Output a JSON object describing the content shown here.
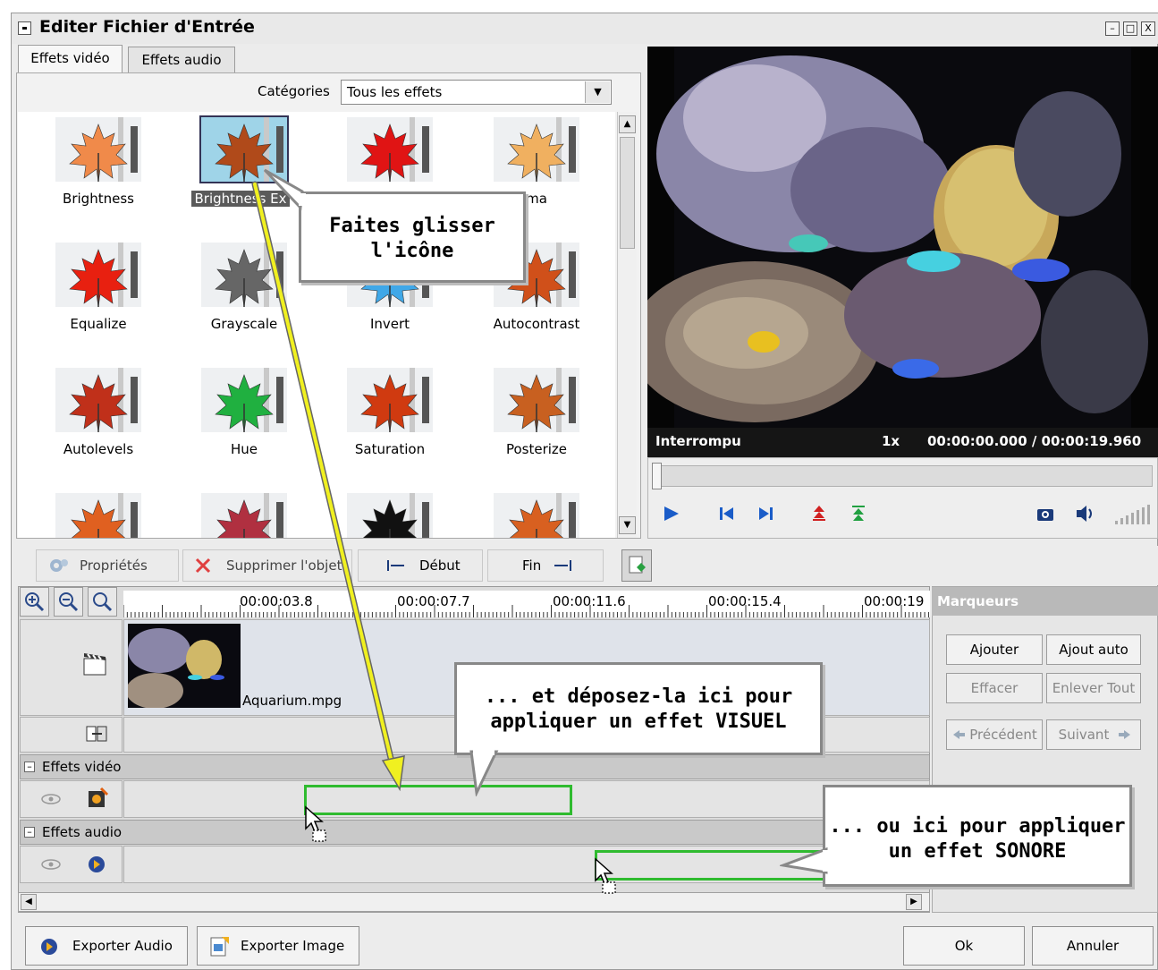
{
  "window": {
    "title": "Editer Fichier d'Entrée",
    "controls": [
      "–",
      "□",
      "X"
    ]
  },
  "tabs": [
    {
      "label": "Effets vidéo",
      "active": true
    },
    {
      "label": "Effets audio",
      "active": false
    }
  ],
  "categories": {
    "label": "Catégories",
    "selected": "Tous les effets"
  },
  "effects": [
    {
      "label": "Brightness",
      "icon": "maple-leaf-orange-icon",
      "color": "#f08a4a"
    },
    {
      "label": "Brightness Ex",
      "icon": "maple-leaf-brown-icon",
      "color": "#b04a1a",
      "selected": true
    },
    {
      "label": "",
      "icon": "maple-leaf-red-icon",
      "color": "#e01414"
    },
    {
      "label": "ma",
      "icon": "maple-leaf-light-orange-icon",
      "color": "#f0b060"
    },
    {
      "label": "Equalize",
      "icon": "maple-leaf-red-icon",
      "color": "#e82010"
    },
    {
      "label": "Grayscale",
      "icon": "maple-leaf-gray-icon",
      "color": "#666666"
    },
    {
      "label": "Invert",
      "icon": "maple-leaf-inverted-icon",
      "color": "#40a8e8"
    },
    {
      "label": "Autocontrast",
      "icon": "maple-leaf-orange-icon",
      "color": "#d0501a"
    },
    {
      "label": "Autolevels",
      "icon": "maple-leaf-red-icon",
      "color": "#c0301a"
    },
    {
      "label": "Hue",
      "icon": "maple-leaf-green-icon",
      "color": "#20b040"
    },
    {
      "label": "Saturation",
      "icon": "maple-leaf-red-icon",
      "color": "#d03a10"
    },
    {
      "label": "Posterize",
      "icon": "maple-leaf-orange-icon",
      "color": "#c86020"
    },
    {
      "label": "",
      "icon": "maple-leaf-orange-icon",
      "color": "#e06020"
    },
    {
      "label": "",
      "icon": "maple-leaf-red-icon",
      "color": "#b03040"
    },
    {
      "label": "",
      "icon": "maple-leaf-black-icon",
      "color": "#111111"
    },
    {
      "label": "",
      "icon": "maple-leaf-orange-icon",
      "color": "#d86020"
    }
  ],
  "player": {
    "status": "Interrompu",
    "speed": "1x",
    "time": "00:00:00.000 / 00:00:19.960",
    "progress": 0
  },
  "toolbar": {
    "properties": "Propriétés",
    "delete": "Supprimer l'objet",
    "start": "Début",
    "end": "Fin"
  },
  "ruler": [
    "00:00:03.8",
    "00:00:07.7",
    "00:00:11.6",
    "00:00:15.4",
    "00:00:19"
  ],
  "clip": {
    "name": "Aquarium.mpg"
  },
  "groups": {
    "video": "Effets vidéo",
    "audio": "Effets audio"
  },
  "markers": {
    "title": "Marqueurs",
    "add": "Ajouter",
    "auto_add": "Ajout auto",
    "erase": "Effacer",
    "remove_all": "Enlever Tout",
    "previous": "Précédent",
    "next": "Suivant"
  },
  "bottom": {
    "export_audio": "Exporter Audio",
    "export_image": "Exporter Image",
    "ok": "Ok",
    "cancel": "Annuler"
  },
  "callouts": {
    "drag": "Faites glisser\nl'icône",
    "drop_visual": "... et déposez-la ici pour\nappliquer un effet VISUEL",
    "drop_audio": "... ou ici pour appliquer\nun effet SONORE"
  },
  "colors": {
    "arrow": "#f0f020",
    "drop_box": "#2fbb2f",
    "status_bg": "#151515",
    "marq_header": "#b9b9b9"
  }
}
